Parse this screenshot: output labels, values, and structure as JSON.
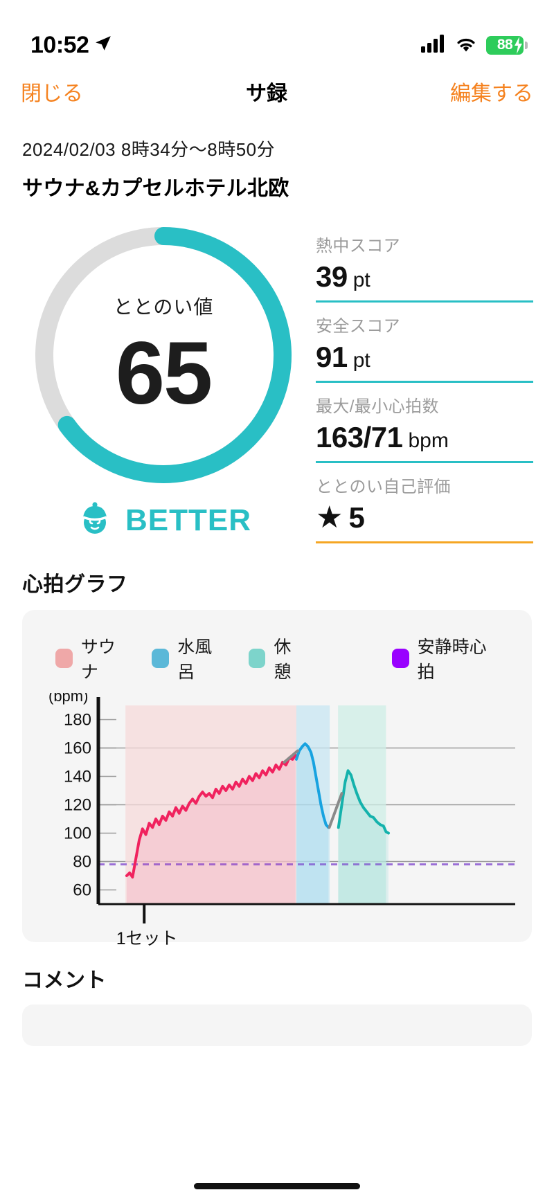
{
  "status_bar": {
    "time": "10:52",
    "location_icon": "location-arrow-icon",
    "cellular_icon": "cellular-bars-icon",
    "wifi_icon": "wifi-icon",
    "battery_percent": "88",
    "battery_charging_icon": "bolt-icon"
  },
  "nav": {
    "close_label": "閉じる",
    "title": "サ録",
    "edit_label": "編集する"
  },
  "header": {
    "date_range": "2024/02/03 8時34分〜8時50分",
    "venue": "サウナ&カプセルホテル北欧"
  },
  "gauge": {
    "label": "ととのい値",
    "value": "65",
    "percent": 65,
    "arc_color": "#29BFC5",
    "track_color": "#DCDCDC",
    "verdict": "BETTER",
    "verdict_icon": "sauna-hat-face-icon",
    "verdict_color": "#29BFC5"
  },
  "stats": [
    {
      "label": "熱中スコア",
      "value": "39",
      "unit": "pt",
      "rule_color": "#29BFC5"
    },
    {
      "label": "安全スコア",
      "value": "91",
      "unit": "pt",
      "rule_color": "#29BFC5"
    },
    {
      "label": "最大/最小心拍数",
      "value": "163/71",
      "unit": "bpm",
      "rule_color": "#29BFC5"
    },
    {
      "label": "ととのい自己評価",
      "value": "5",
      "unit": "",
      "icon": "star-icon",
      "rule_color": "#F5A623"
    }
  ],
  "chart_section": {
    "title": "心拍グラフ"
  },
  "comment_section": {
    "title": "コメント"
  },
  "chart_data": {
    "type": "line",
    "title": "心拍グラフ",
    "xlabel": "",
    "ylabel": "(bpm)",
    "ylim": [
      50,
      190
    ],
    "yticks": [
      180,
      160,
      140,
      120,
      100,
      80,
      60
    ],
    "gridlines": [
      160,
      120,
      80
    ],
    "grid": true,
    "legend_position": "top",
    "legend": [
      {
        "name": "サウナ",
        "color": "#EFA8A8"
      },
      {
        "name": "水風呂",
        "color": "#5BB8D8"
      },
      {
        "name": "休憩",
        "color": "#7DD4CB"
      },
      {
        "name": "安静時心拍",
        "color": "#9900FF"
      }
    ],
    "annotations": [
      {
        "text": "1セット",
        "x_pct": 11
      }
    ],
    "resting_hr": 78,
    "resting_hr_label": "安静時心拍",
    "phases": [
      {
        "name": "サウナ",
        "band_color": "#F6DADA",
        "line_color": "#F0225E",
        "x_start_pct": 6.5,
        "x_end_pct": 47.5
      },
      {
        "name": "水風呂",
        "band_color": "#C7E6F2",
        "line_color": "#18A3E0",
        "x_start_pct": 47.5,
        "x_end_pct": 55.5
      },
      {
        "name": "休憩",
        "band_color": "#CDEDE6",
        "line_color": "#14B2AC",
        "x_start_pct": 57.5,
        "x_end_pct": 69.0
      }
    ],
    "series": [
      {
        "name": "サウナ",
        "color": "#F0225E",
        "points": [
          [
            6.8,
            70
          ],
          [
            7.5,
            72
          ],
          [
            8.2,
            69
          ],
          [
            9.0,
            82
          ],
          [
            9.8,
            95
          ],
          [
            10.6,
            103
          ],
          [
            11.4,
            99
          ],
          [
            12.2,
            107
          ],
          [
            13.0,
            104
          ],
          [
            13.8,
            110
          ],
          [
            14.6,
            106
          ],
          [
            15.4,
            112
          ],
          [
            16.2,
            109
          ],
          [
            17.0,
            115
          ],
          [
            17.8,
            112
          ],
          [
            18.6,
            118
          ],
          [
            19.4,
            114
          ],
          [
            20.2,
            119
          ],
          [
            21.0,
            116
          ],
          [
            21.8,
            121
          ],
          [
            22.6,
            124
          ],
          [
            23.4,
            121
          ],
          [
            24.2,
            126
          ],
          [
            25.0,
            129
          ],
          [
            25.8,
            126
          ],
          [
            26.6,
            128
          ],
          [
            27.4,
            125
          ],
          [
            28.2,
            131
          ],
          [
            29.0,
            128
          ],
          [
            29.8,
            133
          ],
          [
            30.6,
            130
          ],
          [
            31.4,
            134
          ],
          [
            32.2,
            131
          ],
          [
            33.0,
            136
          ],
          [
            33.8,
            133
          ],
          [
            34.6,
            138
          ],
          [
            35.4,
            135
          ],
          [
            36.2,
            140
          ],
          [
            37.0,
            137
          ],
          [
            37.8,
            142
          ],
          [
            38.6,
            139
          ],
          [
            39.4,
            144
          ],
          [
            40.2,
            141
          ],
          [
            41.0,
            146
          ],
          [
            41.8,
            143
          ],
          [
            42.6,
            148
          ],
          [
            43.4,
            145
          ],
          [
            44.2,
            150
          ],
          [
            45.0,
            148
          ],
          [
            45.8,
            153
          ],
          [
            46.6,
            152
          ],
          [
            47.3,
            155
          ]
        ]
      },
      {
        "name": "水風呂",
        "color": "#18A3E0",
        "points": [
          [
            47.5,
            152
          ],
          [
            48.2,
            158
          ],
          [
            48.9,
            161
          ],
          [
            49.6,
            163
          ],
          [
            50.3,
            161
          ],
          [
            51.0,
            157
          ],
          [
            51.6,
            150
          ],
          [
            52.2,
            140
          ],
          [
            52.8,
            130
          ],
          [
            53.4,
            120
          ],
          [
            54.0,
            112
          ],
          [
            54.6,
            106
          ],
          [
            55.2,
            104
          ]
        ]
      },
      {
        "name": "休憩",
        "color": "#14B2AC",
        "points": [
          [
            57.6,
            104
          ],
          [
            58.4,
            120
          ],
          [
            59.2,
            136
          ],
          [
            59.9,
            144
          ],
          [
            60.6,
            141
          ],
          [
            61.3,
            134
          ],
          [
            62.0,
            128
          ],
          [
            62.8,
            122
          ],
          [
            63.6,
            118
          ],
          [
            64.4,
            115
          ],
          [
            65.2,
            112
          ],
          [
            66.0,
            111
          ],
          [
            66.8,
            108
          ],
          [
            67.6,
            106
          ],
          [
            68.4,
            105
          ],
          [
            69.0,
            101
          ],
          [
            69.6,
            100
          ]
        ]
      }
    ],
    "marker_segments": [
      {
        "from": [
          44.6,
          150
        ],
        "to": [
          47.8,
          158
        ],
        "color": "#8A8A8A"
      },
      {
        "from": [
          55.4,
          104
        ],
        "to": [
          58.4,
          128
        ],
        "color": "#8A8A8A"
      }
    ]
  }
}
